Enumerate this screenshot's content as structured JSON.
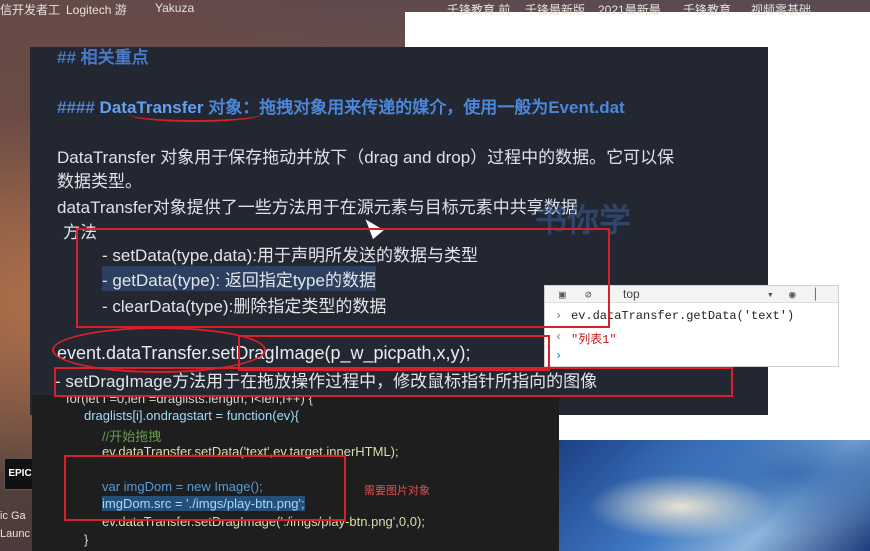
{
  "topbar": {
    "items": [
      "信开发者工",
      "Logitech 游",
      "Yakuza",
      "千锋教育 前",
      "千锋最新版",
      "2021最新最",
      "千锋教育",
      "视频零基础"
    ]
  },
  "desktop": {
    "left_labels": [
      "ic Ga",
      "Launc"
    ],
    "epic_icon_text": "EPIC"
  },
  "markdown": {
    "heading2": "## 相关重点",
    "heading4_prefix": "#### ",
    "heading4_object": "DataTransfer",
    "heading4_rest": " 对象：拖拽对象用来传递的媒介，使用一般为Event.dat",
    "para1_line1": "DataTransfer 对象用于保存拖动并放下（drag and drop）过程中的数据。它可以保",
    "para1_line2": "数据类型。",
    "para2": "dataTransfer对象提供了一些方法用于在源元素与目标元素中共享数据",
    "methods_label": "方法",
    "methods": [
      "- setData(type,data):用于声明所发送的数据与类型",
      "- getData(type): 返回指定type的数据",
      "- clearData(type):删除指定类型的数据"
    ],
    "event_line": "event.dataTransfer.setDragImage(p_w_picpath,x,y);",
    "desc_line": "- setDragImage方法用于在拖放操作过程中，修改鼠标指针所指向的图像",
    "watermark": "书你学"
  },
  "code": {
    "lines": [
      "for(let i =0,len =draglists.length; i<len;i++) {",
      "draglists[i].ondragstart = function(ev){",
      "//开始拖拽",
      "ev.dataTransfer.setData('text',ev.target.innerHTML);",
      "",
      "var imgDom = new Image();",
      "imgDom.src = './imgs/play-btn.png';",
      "ev.dataTransfer.setDragImage('./imgs/play-btn.png',0,0);",
      "}"
    ],
    "note": "需要图片对象"
  },
  "console": {
    "context": "top",
    "input": "ev.dataTransfer.getData('text')",
    "output": "\"列表1\""
  },
  "colors": {
    "editor_bg": "#232731",
    "code_bg": "#1e1e1e",
    "annotation_red": "#d8202a",
    "heading_blue": "#4c86d8"
  }
}
